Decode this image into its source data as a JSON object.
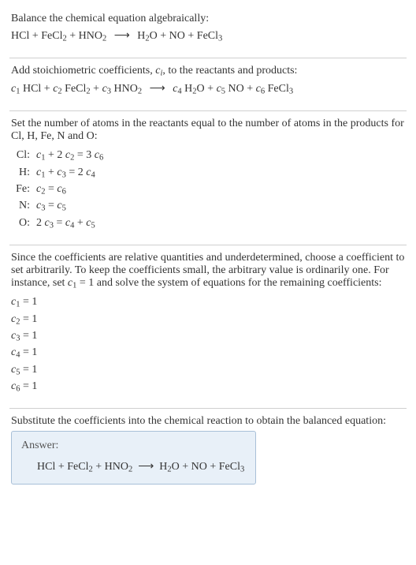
{
  "section1": {
    "intro": "Balance the chemical equation algebraically:",
    "eq_lhs": "HCl + FeCl",
    "eq_lhs2": " + HNO",
    "arrow": "⟶",
    "eq_rhs": "H",
    "eq_rhs2": "O + NO + FeCl"
  },
  "section2": {
    "intro_part1": "Add stoichiometric coefficients, ",
    "intro_ci": "c",
    "intro_i": "i",
    "intro_part2": ", to the reactants and products:",
    "c1": "c",
    "hcl": " HCl + ",
    "c2": "c",
    "fecl2": " FeCl",
    "plus2": " + ",
    "c3": "c",
    "hno2": " HNO",
    "arrow": "⟶",
    "c4": "c",
    "h2o": " H",
    "o_plus": "O + ",
    "c5": "c",
    "no_plus": " NO + ",
    "c6": "c",
    "fecl3": " FeCl"
  },
  "section3": {
    "intro": "Set the number of atoms in the reactants equal to the number of atoms in the products for Cl, H, Fe, N and O:",
    "atoms": [
      {
        "label": "Cl:",
        "eq_html": "<span class='italic'>c</span><sub>1</sub> + 2 <span class='italic'>c</span><sub>2</sub> = 3 <span class='italic'>c</span><sub>6</sub>"
      },
      {
        "label": "H:",
        "eq_html": "<span class='italic'>c</span><sub>1</sub> + <span class='italic'>c</span><sub>3</sub> = 2 <span class='italic'>c</span><sub>4</sub>"
      },
      {
        "label": "Fe:",
        "eq_html": "<span class='italic'>c</span><sub>2</sub> = <span class='italic'>c</span><sub>6</sub>"
      },
      {
        "label": "N:",
        "eq_html": "<span class='italic'>c</span><sub>3</sub> = <span class='italic'>c</span><sub>5</sub>"
      },
      {
        "label": "O:",
        "eq_html": "2 <span class='italic'>c</span><sub>3</sub> = <span class='italic'>c</span><sub>4</sub> + <span class='italic'>c</span><sub>5</sub>"
      }
    ]
  },
  "section4": {
    "intro_html": "Since the coefficients are relative quantities and underdetermined, choose a coefficient to set arbitrarily. To keep the coefficients small, the arbitrary value is ordinarily one. For instance, set <span class='italic'>c</span><sub>1</sub> = 1 and solve the system of equations for the remaining coefficients:",
    "coeffs": [
      {
        "html": "<span class='italic'>c</span><sub>1</sub> = 1"
      },
      {
        "html": "<span class='italic'>c</span><sub>2</sub> = 1"
      },
      {
        "html": "<span class='italic'>c</span><sub>3</sub> = 1"
      },
      {
        "html": "<span class='italic'>c</span><sub>4</sub> = 1"
      },
      {
        "html": "<span class='italic'>c</span><sub>5</sub> = 1"
      },
      {
        "html": "<span class='italic'>c</span><sub>6</sub> = 1"
      }
    ]
  },
  "section5": {
    "intro": "Substitute the coefficients into the chemical reaction to obtain the balanced equation:",
    "answer_label": "Answer:",
    "answer_html": "HCl + FeCl<sub>2</sub> + HNO<sub>2</sub> &nbsp;⟶&nbsp; H<sub>2</sub>O + NO + FeCl<sub>3</sub>"
  }
}
